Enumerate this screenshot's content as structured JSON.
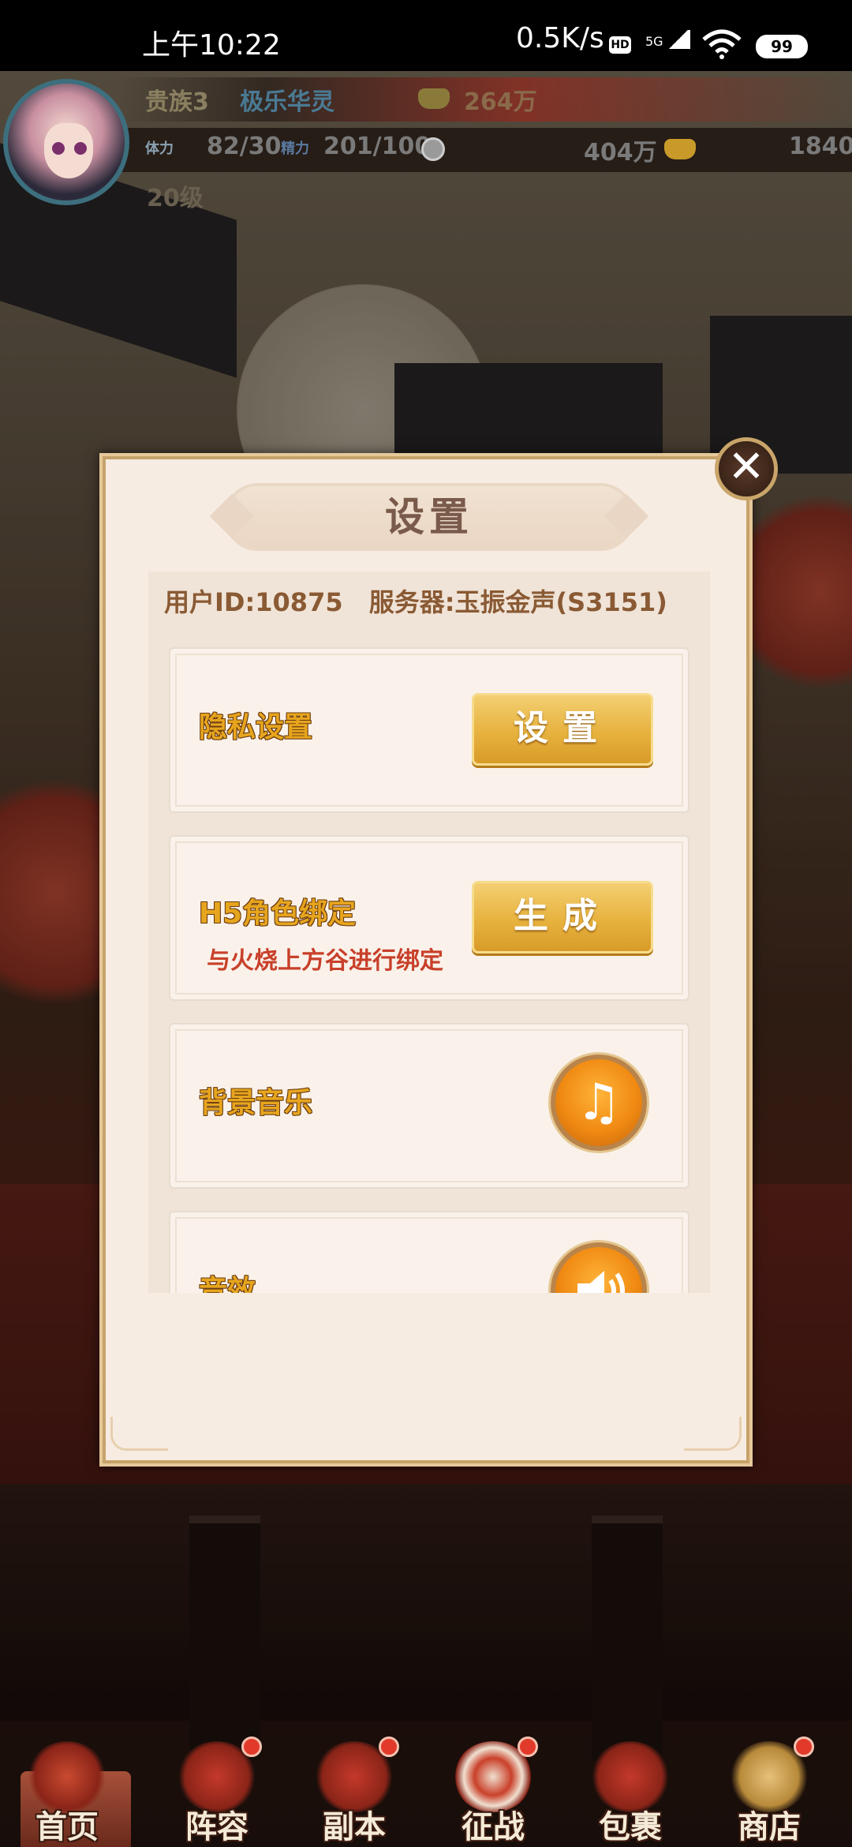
{
  "status_bar": {
    "time": "上午10:22",
    "network_speed": "0.5K/s",
    "hd_badge": "HD",
    "signal_label": "5G",
    "battery": "99"
  },
  "player": {
    "title": "贵族3",
    "name": "极乐华灵",
    "power": "264万",
    "stamina_label": "体力",
    "stamina": "82/30",
    "energy_label": "精力",
    "energy": "201/100",
    "copper": "404万",
    "ingots": "1840",
    "level": "20级"
  },
  "dialog": {
    "title": "设置",
    "close_glyph": "✕",
    "user_id": "用户ID:10875",
    "server": "服务器:玉振金声(S3151)",
    "rows": [
      {
        "label": "隐私设置",
        "button": "设置"
      },
      {
        "label": "H5角色绑定",
        "sublabel": "与火烧上方谷进行绑定",
        "button": "生成"
      },
      {
        "label": "背景音乐",
        "icon": "music-note-icon"
      },
      {
        "label": "音效",
        "icon": "speaker-icon"
      }
    ]
  },
  "bottom_nav": {
    "items": [
      {
        "label": "首页",
        "active": true,
        "badge": false
      },
      {
        "label": "阵容",
        "badge": true
      },
      {
        "label": "副本",
        "badge": true
      },
      {
        "label": "征战",
        "badge": true
      },
      {
        "label": "包裹",
        "badge": false
      },
      {
        "label": "商店",
        "badge": true
      }
    ]
  },
  "colors": {
    "accent_gold": "#e7b23e",
    "label_orange": "#e6a51e",
    "sublabel_red": "#c8402a",
    "dialog_bg": "#f7ece2"
  }
}
